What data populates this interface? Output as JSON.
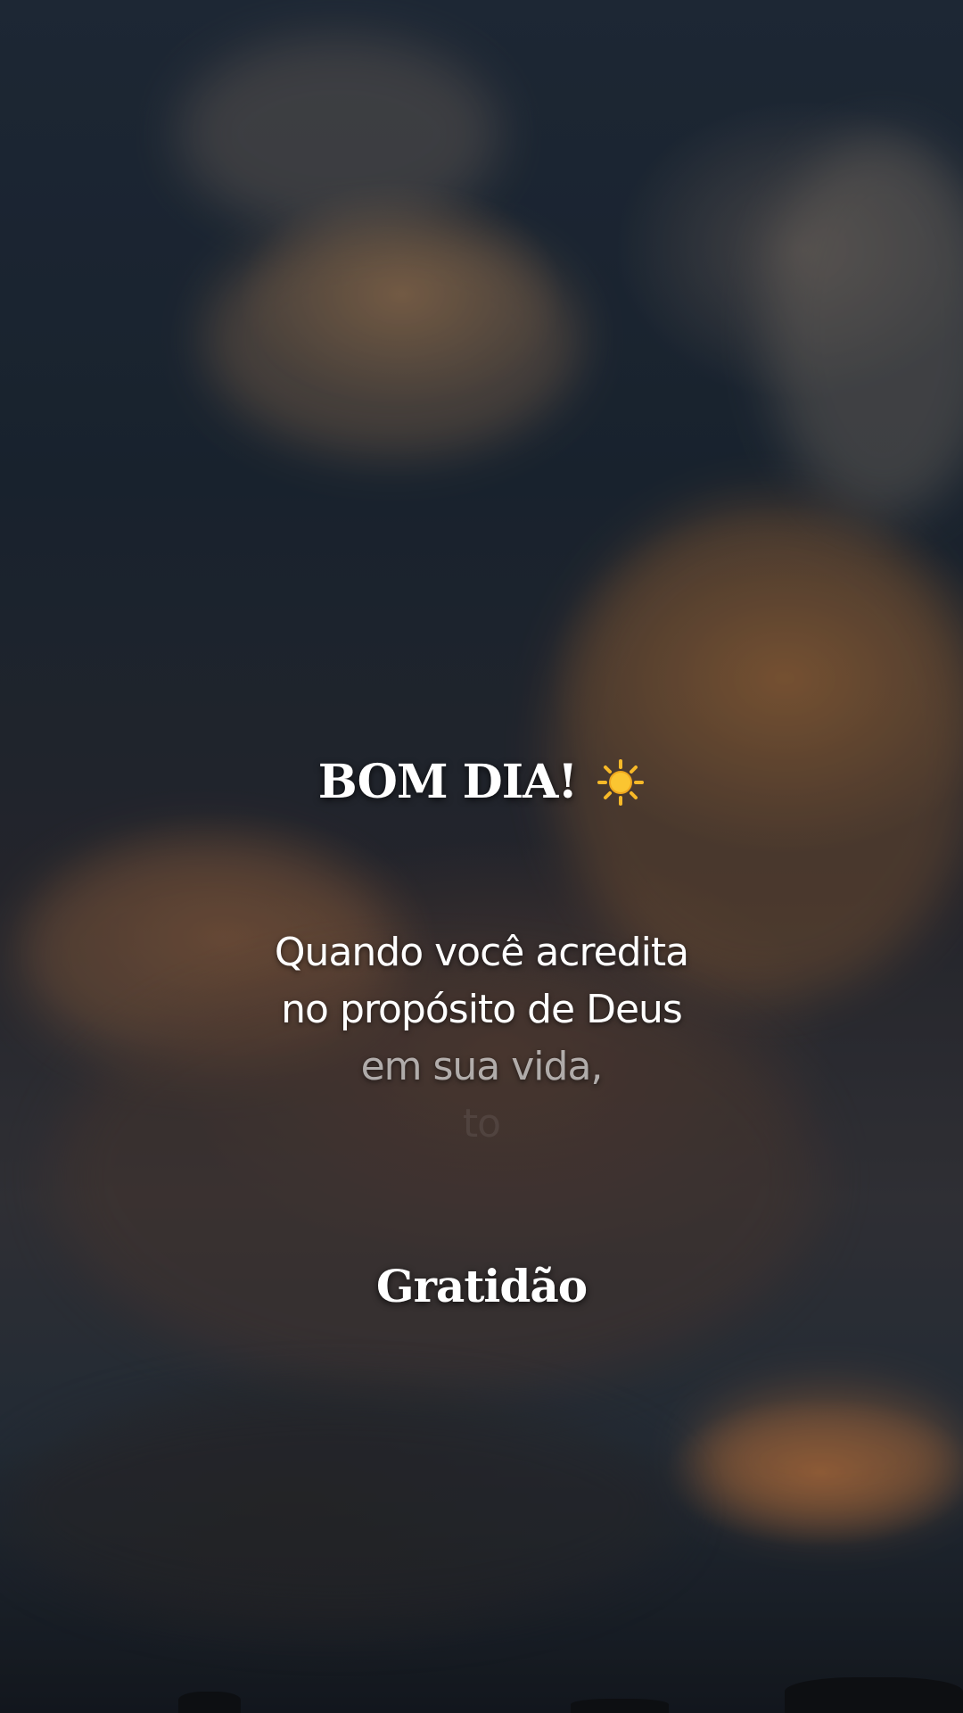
{
  "story": {
    "greeting": "BOM DIA!",
    "greeting_icon": "sun-icon",
    "quote_lines": [
      "Quando você acredita",
      "no propósito de Deus",
      "em sua vida,",
      "to"
    ],
    "signoff": "Gratidão"
  },
  "colors": {
    "text": "#ffffff",
    "sun": "#f7b928",
    "sky_dark": "#1e2a38",
    "cloud_glow": "#c4803f"
  }
}
